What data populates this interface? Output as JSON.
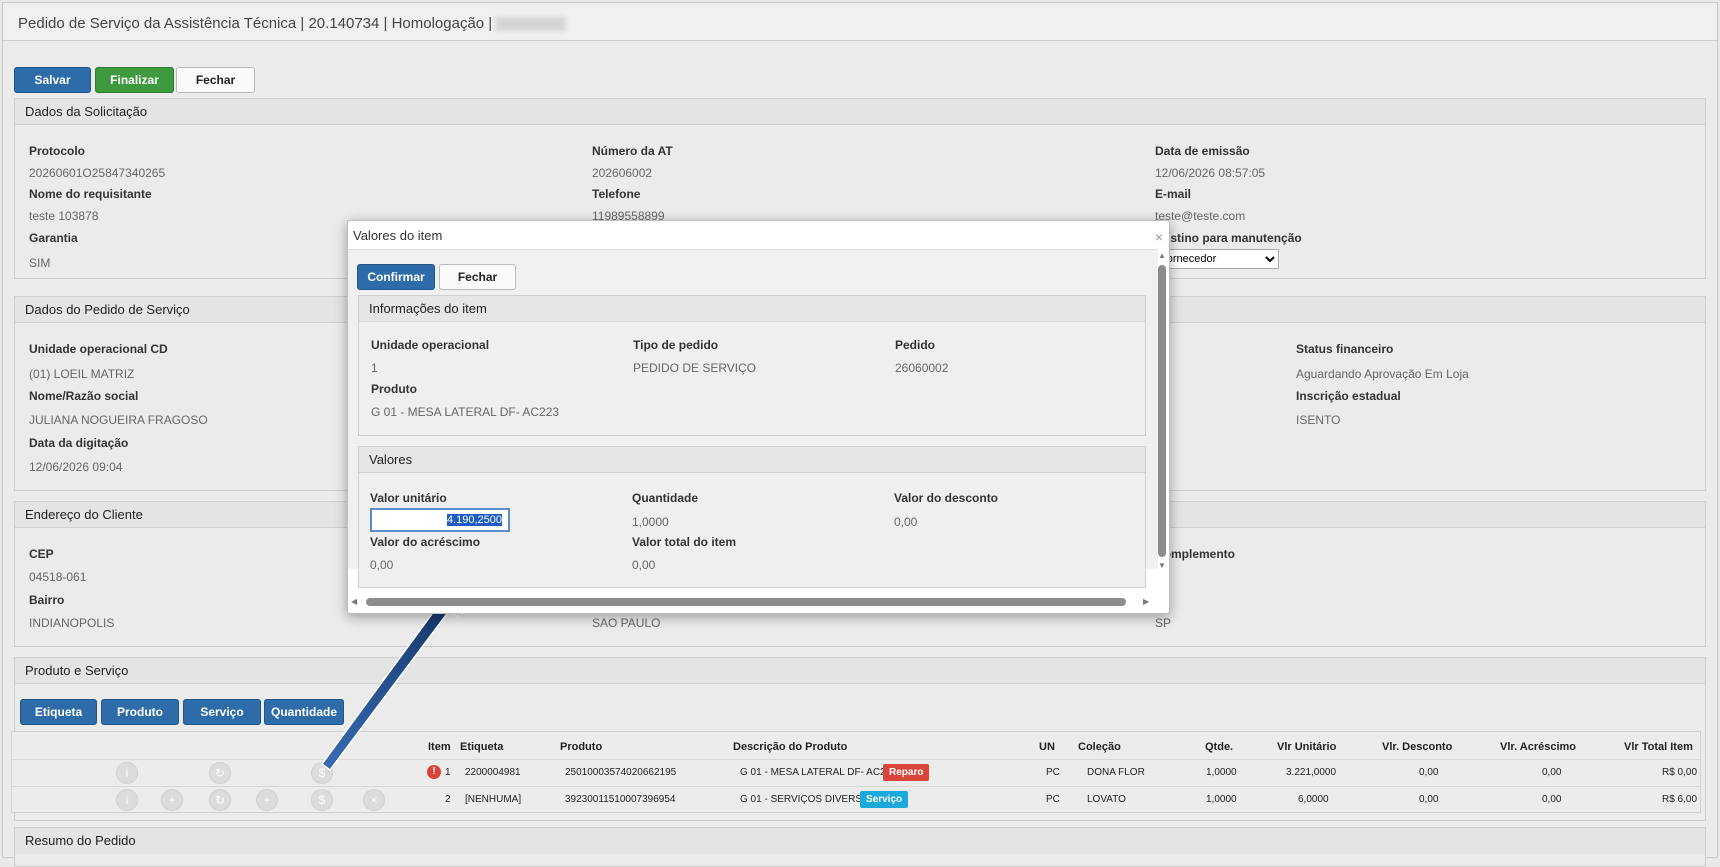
{
  "header": {
    "title": "Pedido de Serviço da Assistência Técnica | 20.140734 | Homologação |"
  },
  "toolbar": {
    "save": "Salvar",
    "finish": "Finalizar",
    "close": "Fechar"
  },
  "solicitacao": {
    "title": "Dados da Solicitação",
    "protocolo_label": "Protocolo",
    "protocolo": "20260601O25847340265",
    "numero_at_label": "Número da AT",
    "numero_at": "202606002",
    "data_emissao_label": "Data de emissão",
    "data_emissao": "12/06/2026 08:57:05",
    "nome_label": "Nome do requisitante",
    "nome": "teste 103878",
    "telefone_label": "Telefone",
    "telefone": "11989558899",
    "email_label": "E-mail",
    "email": "teste@teste.com",
    "garantia_label": "Garantia",
    "garantia": "SIM",
    "destino_label": "Destino para manutenção",
    "destino": "Fornecedor"
  },
  "pedido": {
    "title": "Dados do Pedido de Serviço",
    "unidade_label": "Unidade operacional CD",
    "unidade": "(01) LOEIL MATRIZ",
    "nome_label": "Nome/Razão social",
    "nome": "JULIANA NOGUEIRA FRAGOSO",
    "data_label": "Data da digitação",
    "data": "12/06/2026 09:04",
    "status_label": "Status financeiro",
    "status": "Aguardando Aprovação Em Loja",
    "inscricao_label": "Inscrição estadual",
    "inscricao": "ISENTO"
  },
  "endereco": {
    "title": "Endereço do Cliente",
    "cep_label": "CEP",
    "cep": "04518-061",
    "bairro_label": "Bairro",
    "bairro": "INDIANOPOLIS",
    "cidade": "SAO PAULO",
    "complemento_label": "Complemento",
    "uf": "SP"
  },
  "produtos": {
    "title": "Produto e Serviço",
    "buttons": [
      "Etiqueta",
      "Produto",
      "Serviço",
      "Quantidade"
    ],
    "columns": [
      "Item",
      "Etiqueta",
      "Produto",
      "Descrição do Produto",
      "UN",
      "Coleção",
      "Qtde.",
      "Vlr Unitário",
      "Vlr. Desconto",
      "Vlr. Acréscimo",
      "Vlr Total Item"
    ],
    "rows": [
      {
        "item": "1",
        "etiqueta": "2200004981",
        "produto": "25010003574020662195",
        "descricao": "G 01 - MESA LATERAL DF- AC223",
        "badge": "Reparo",
        "un": "PC",
        "colecao": "DONA FLOR",
        "qtde": "1,0000",
        "unit": "3.221,0000",
        "desc": "0,00",
        "acr": "0,00",
        "total": "R$ 0,00"
      },
      {
        "item": "2",
        "etiqueta": "[NENHUMA]",
        "produto": "39230011510007396954",
        "descricao": "G 01 - SERVIÇOS DIVERSOS",
        "badge": "Serviço",
        "un": "PC",
        "colecao": "LOVATO",
        "qtde": "1,0000",
        "unit": "6,0000",
        "desc": "0,00",
        "acr": "0,00",
        "total": "R$ 6,00"
      }
    ]
  },
  "resumo": {
    "title": "Resumo do Pedido"
  },
  "modal": {
    "title": "Valores do item",
    "close_glyph": "×",
    "confirm": "Confirmar",
    "close": "Fechar",
    "info_title": "Informações do item",
    "unidade_label": "Unidade operacional",
    "unidade": "1",
    "tipo_label": "Tipo de pedido",
    "tipo": "PEDIDO DE SERVIÇO",
    "pedido_label": "Pedido",
    "pedido": "26060002",
    "produto_label": "Produto",
    "produto": "G 01 - MESA LATERAL DF- AC223",
    "valores_title": "Valores",
    "unitario_label": "Valor unitário",
    "unitario": "4.190,2500",
    "quantidade_label": "Quantidade",
    "quantidade": "1,0000",
    "desconto_label": "Valor do desconto",
    "desconto": "0,00",
    "acrescimo_label": "Valor do acréscimo",
    "acrescimo": "0,00",
    "total_label": "Valor total do item",
    "total": "0,00"
  },
  "colors": {
    "primary": "#2d6ca8",
    "success": "#3d9a3f",
    "danger": "#d9453b",
    "info": "#1aa9d8",
    "arrow": "#1b3f75"
  }
}
